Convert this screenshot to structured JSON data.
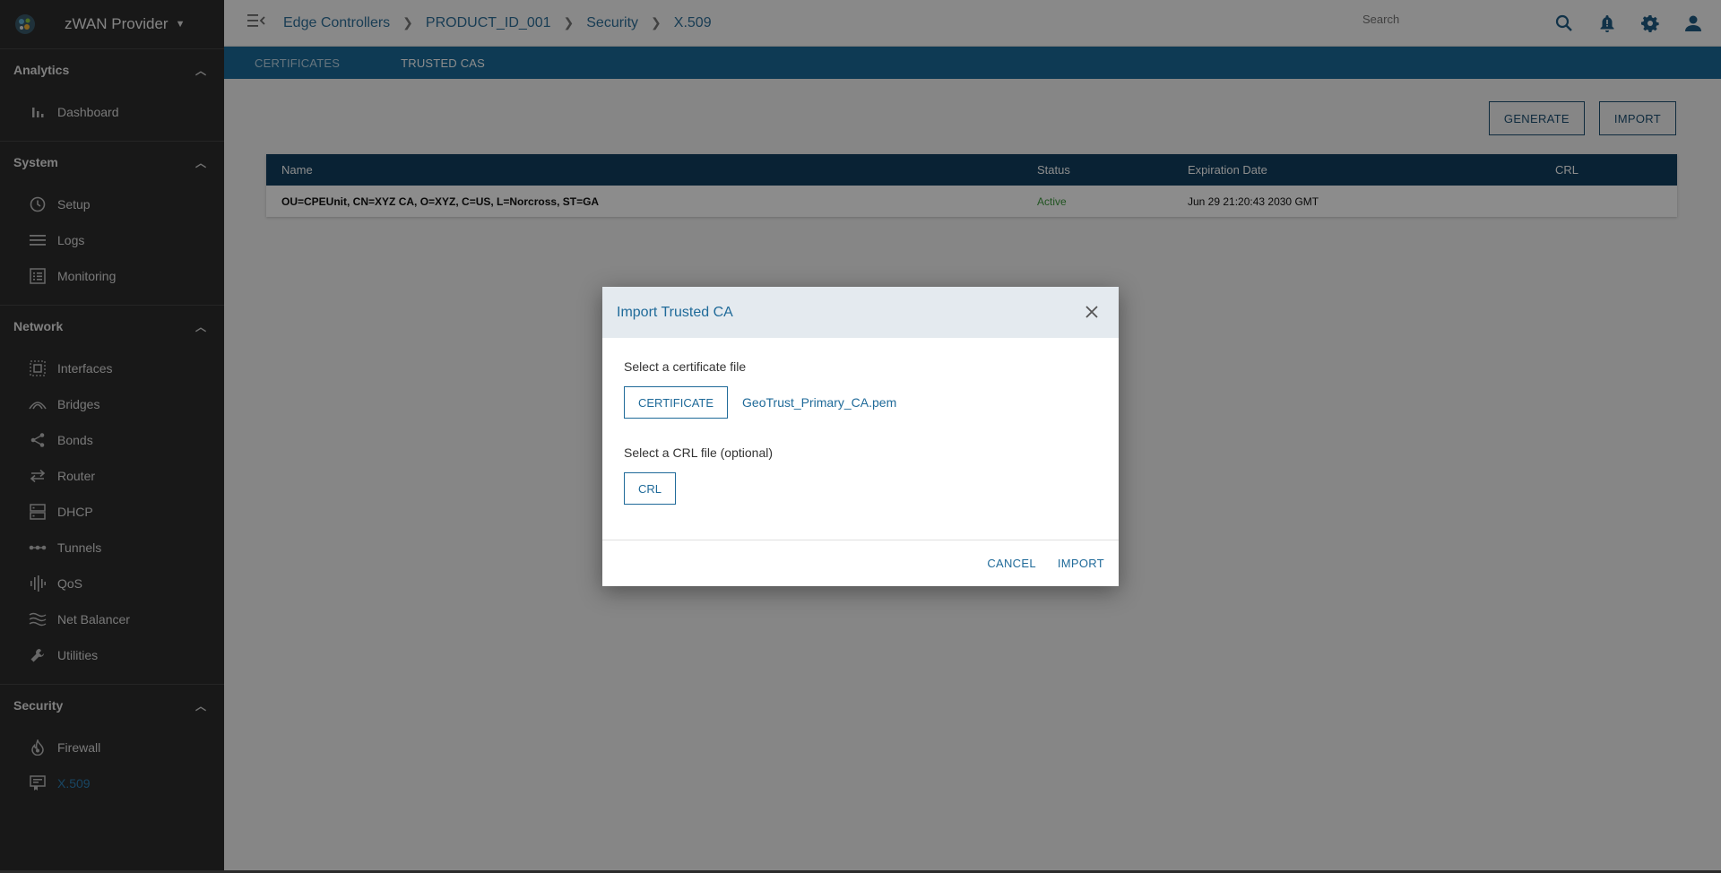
{
  "brand": {
    "name": "zWAN Provider"
  },
  "sidebar": {
    "sections": [
      {
        "title": "Analytics",
        "items": [
          {
            "label": "Dashboard",
            "icon": "bar-chart-icon"
          }
        ]
      },
      {
        "title": "System",
        "items": [
          {
            "label": "Setup",
            "icon": "clock-icon"
          },
          {
            "label": "Logs",
            "icon": "lines-icon"
          },
          {
            "label": "Monitoring",
            "icon": "list-box-icon"
          }
        ]
      },
      {
        "title": "Network",
        "items": [
          {
            "label": "Interfaces",
            "icon": "interfaces-icon"
          },
          {
            "label": "Bridges",
            "icon": "bridge-icon"
          },
          {
            "label": "Bonds",
            "icon": "share-icon"
          },
          {
            "label": "Router",
            "icon": "swap-arrows-icon"
          },
          {
            "label": "DHCP",
            "icon": "server-icon"
          },
          {
            "label": "Tunnels",
            "icon": "tunnel-icon"
          },
          {
            "label": "QoS",
            "icon": "equalizer-icon"
          },
          {
            "label": "Net Balancer",
            "icon": "waves-icon"
          },
          {
            "label": "Utilities",
            "icon": "wrench-icon"
          }
        ]
      },
      {
        "title": "Security",
        "items": [
          {
            "label": "Firewall",
            "icon": "flame-icon"
          },
          {
            "label": "X.509",
            "icon": "certificate-icon"
          }
        ]
      }
    ]
  },
  "topbar": {
    "breadcrumbs": [
      "Edge Controllers",
      "PRODUCT_ID_001",
      "Security",
      "X.509"
    ],
    "search_placeholder": "Search"
  },
  "tabs": [
    {
      "label": "CERTIFICATES"
    },
    {
      "label": "TRUSTED CAS"
    }
  ],
  "actions": {
    "generate": "GENERATE",
    "import": "IMPORT"
  },
  "table": {
    "headers": {
      "name": "Name",
      "status": "Status",
      "expiration": "Expiration Date",
      "crl": "CRL"
    },
    "rows": [
      {
        "name": "OU=CPEUnit, CN=XYZ CA, O=XYZ, C=US, L=Norcross, ST=GA",
        "status": "Active",
        "expiration": "Jun 29 21:20:43 2030 GMT",
        "crl": ""
      }
    ]
  },
  "dialog": {
    "title": "Import Trusted CA",
    "cert_label": "Select a certificate file",
    "cert_button": "CERTIFICATE",
    "cert_file": "GeoTrust_Primary_CA.pem",
    "crl_label": "Select a CRL file (optional)",
    "crl_button": "CRL",
    "cancel": "CANCEL",
    "import": "IMPORT"
  },
  "colors": {
    "accent": "#1f6a99",
    "tabbar": "#1a6b9a",
    "table_header": "#113f5f",
    "sidebar": "#2d2d2d",
    "active_status": "#3d9a3d"
  }
}
